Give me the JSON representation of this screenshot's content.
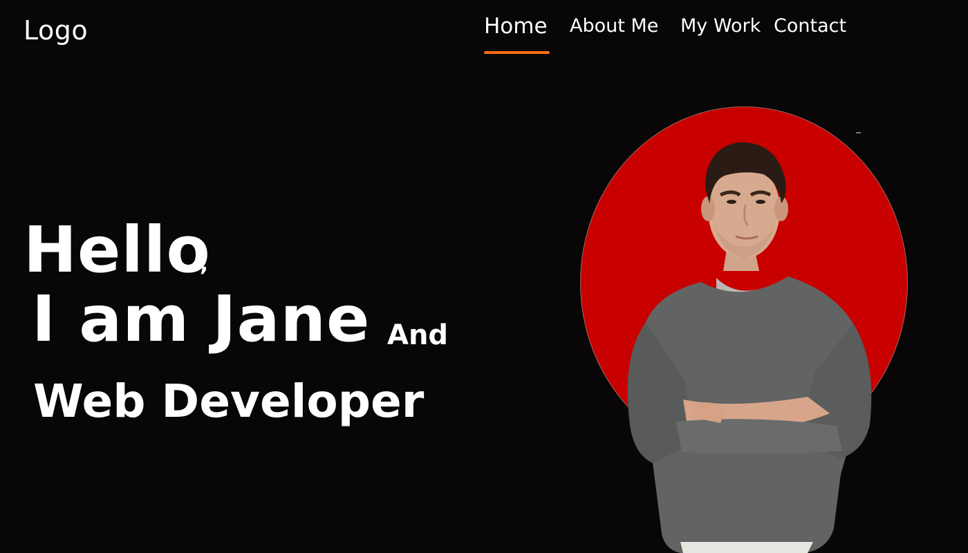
{
  "header": {
    "logo_text": "Logo",
    "nav_items": [
      "Home",
      "About Me",
      "My Work",
      "Contact"
    ],
    "active_item": "Home",
    "accent_color": "#ff6d13"
  },
  "hero": {
    "greeting": "Hello",
    "comma": ",",
    "intro": "I am Jane",
    "connector": "And",
    "role": "Web Developer"
  },
  "portrait": {
    "circle_color": "#c80000"
  }
}
